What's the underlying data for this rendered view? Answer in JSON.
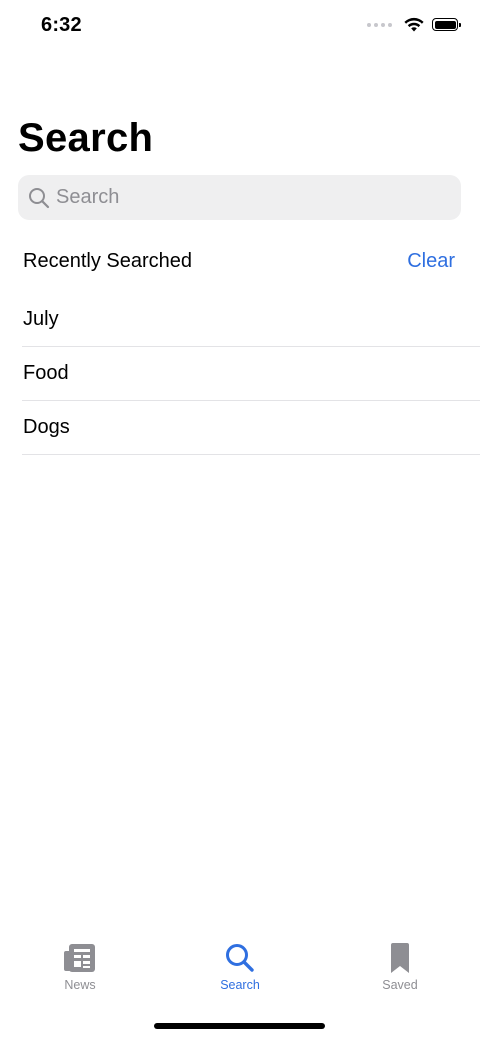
{
  "status_bar": {
    "time": "6:32"
  },
  "header": {
    "title": "Search"
  },
  "search": {
    "placeholder": "Search",
    "value": ""
  },
  "recents": {
    "title": "Recently Searched",
    "clear_label": "Clear",
    "items": [
      {
        "label": "July"
      },
      {
        "label": "Food"
      },
      {
        "label": "Dogs"
      }
    ]
  },
  "tab_bar": {
    "tabs": [
      {
        "label": "News",
        "icon": "newspaper-icon",
        "active": false
      },
      {
        "label": "Search",
        "icon": "search-icon",
        "active": true
      },
      {
        "label": "Saved",
        "icon": "bookmark-icon",
        "active": false
      }
    ]
  },
  "colors": {
    "accent": "#2f6fe0",
    "inactive_tab": "#8e8e93",
    "search_field_bg": "#efeff0",
    "separator": "#e3e3e6"
  }
}
